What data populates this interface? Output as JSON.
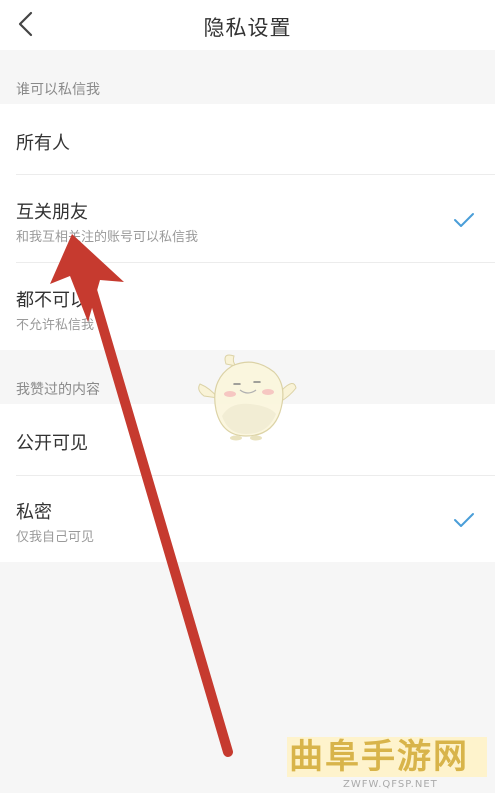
{
  "header": {
    "title": "隐私设置",
    "back_icon": "chevron-left-icon"
  },
  "sections": [
    {
      "label": "谁可以私信我",
      "options": [
        {
          "title": "所有人",
          "subtitle": "",
          "selected": false
        },
        {
          "title": "互关朋友",
          "subtitle": "和我互相关注的账号可以私信我",
          "selected": true
        },
        {
          "title": "都不可以",
          "subtitle": "不允许私信我",
          "selected": false
        }
      ]
    },
    {
      "label": "我赞过的内容",
      "options": [
        {
          "title": "公开可见",
          "subtitle": "",
          "selected": false
        },
        {
          "title": "私密",
          "subtitle": "仅我自己可见",
          "selected": true
        }
      ]
    }
  ],
  "watermark": {
    "text": "曲阜手游网",
    "url": "ZWFW.QFSP.NET"
  },
  "colors": {
    "accent_check": "#4a9ed8",
    "annotation_arrow": "#c63a2f",
    "background": "#f6f6f6",
    "row_background": "#ffffff",
    "watermark_text": "#d8b44a"
  }
}
